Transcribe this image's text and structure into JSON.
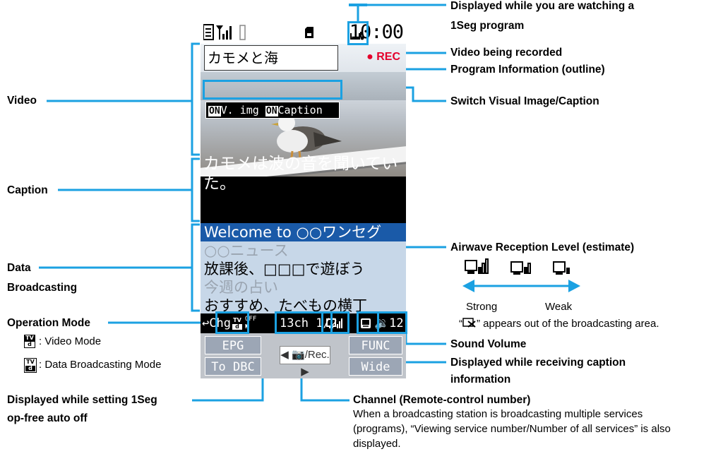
{
  "screen": {
    "clock": "10:00",
    "program_title": "カモメと海",
    "rec": "REC",
    "switch_on_1": "ON",
    "switch_vimg": "V. img",
    "switch_on_2": "ON",
    "switch_caption": "Caption",
    "caption_text": "カモメは波の音を聞いていた。",
    "data_lines": [
      "Welcome to ○○ワンセグ",
      "○○ニュース",
      "放課後、□□□で遊ぼう",
      "今週の占い",
      "おすすめ、たべもの横丁"
    ],
    "status_chg": "Chg",
    "status_channel": "13ch",
    "status_service": "1/2",
    "status_volume": "12",
    "softkey_epg": "EPG",
    "softkey_func": "FUNC",
    "softkey_todbc": "To DBC",
    "softkey_wide": "Wide",
    "center_key": "/Rec."
  },
  "labels": {
    "watching": "Displayed while you are watching a",
    "watching2": "1Seg program",
    "recorded": "Video being recorded",
    "program_info": "Program Information (outline)",
    "switch": "Switch Visual Image/Caption",
    "video": "Video",
    "caption": "Caption",
    "data": "Data",
    "broadcasting": "Broadcasting",
    "airwave": "Airwave Reception Level (estimate)",
    "strong": "Strong",
    "weak": "Weak",
    "out_of_area_pre": "“",
    "out_of_area_post": "” appears out of the broadcasting area.",
    "operation_mode": "Operation Mode",
    "video_mode": ": Video Mode",
    "data_mode": ": Data Broadcasting Mode",
    "sound_volume": "Sound Volume",
    "caption_info": "Displayed while receiving caption",
    "caption_info2": "information",
    "autooff": "Displayed while setting 1Seg",
    "autooff2": "op-free auto off",
    "channel": "Channel (Remote-control number)",
    "channel_desc": "When a broadcasting station is broadcasting multiple services (programs), “Viewing service number/Number of all services” is also displayed."
  },
  "colors": {
    "accent": "#1ba1e2",
    "rec": "#e4002b",
    "selected_row": "#1a5aa8"
  }
}
